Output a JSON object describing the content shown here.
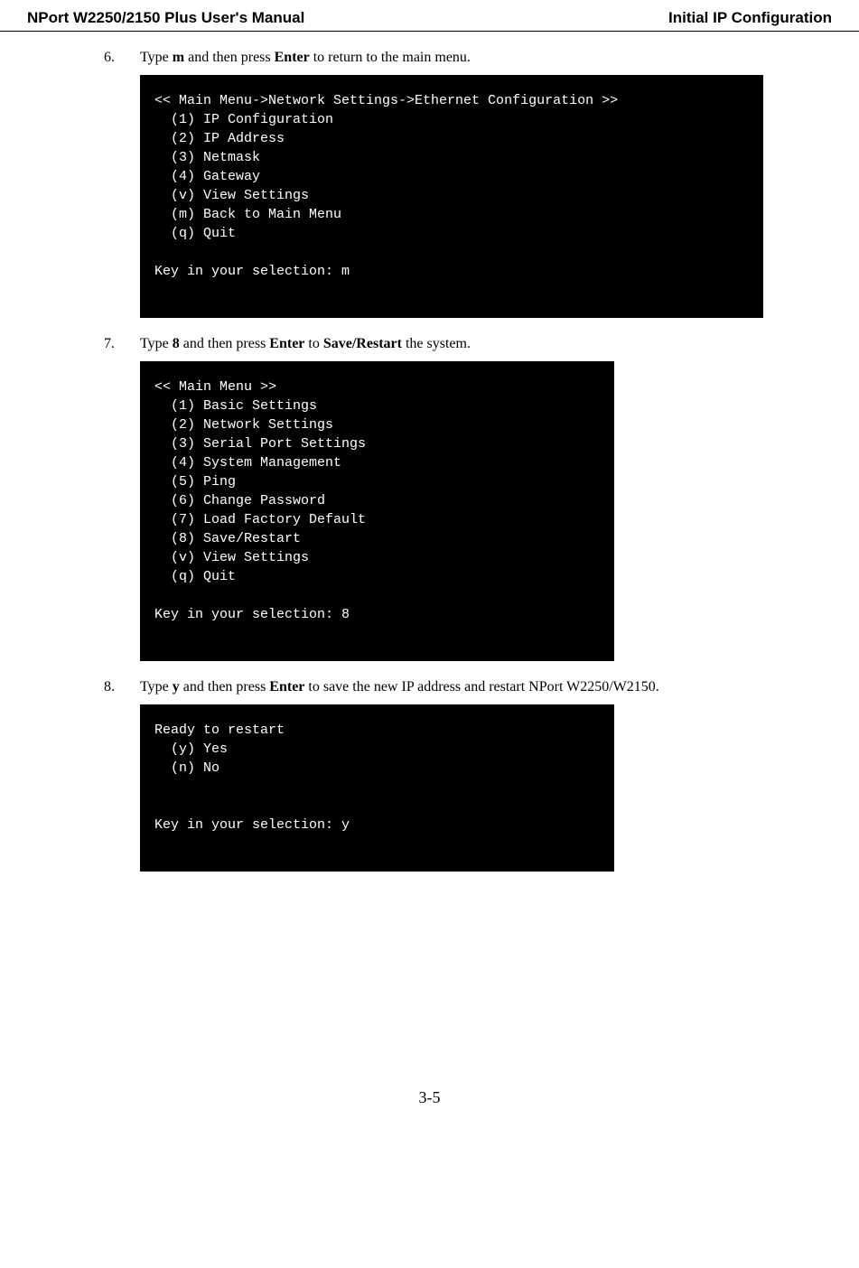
{
  "header": {
    "title": "NPort W2250/2150 Plus User's Manual",
    "section": "Initial IP Configuration"
  },
  "steps": [
    {
      "num": "6.",
      "prefix": "Type ",
      "key": "m",
      "mid": " and then press ",
      "action": "Enter",
      "suffix": " to return to the main menu.",
      "terminal": "<< Main Menu->Network Settings->Ethernet Configuration >>\n  (1) IP Configuration\n  (2) IP Address\n  (3) Netmask\n  (4) Gateway\n  (v) View Settings\n  (m) Back to Main Menu\n  (q) Quit\n\nKey in your selection: m\n\n",
      "terminalClass": "terminal-wide"
    },
    {
      "num": "7.",
      "prefix": "Type ",
      "key": "8",
      "mid": " and then press ",
      "action": "Enter",
      "mid2": " to ",
      "action2": "Save/Restart",
      "suffix": " the system.",
      "terminal": "<< Main Menu >>\n  (1) Basic Settings\n  (2) Network Settings\n  (3) Serial Port Settings\n  (4) System Management\n  (5) Ping\n  (6) Change Password\n  (7) Load Factory Default\n  (8) Save/Restart\n  (v) View Settings\n  (q) Quit\n\nKey in your selection: 8\n\n",
      "terminalClass": "terminal-narrow"
    },
    {
      "num": "8.",
      "prefix": "Type ",
      "key": "y",
      "mid": " and then press ",
      "action": "Enter",
      "suffix": " to save the new IP address and restart NPort W2250/W2150.",
      "terminal": "Ready to restart\n  (y) Yes\n  (n) No\n\n\nKey in your selection: y\n\n",
      "terminalClass": "terminal-narrow"
    }
  ],
  "pageNumber": "3-5"
}
